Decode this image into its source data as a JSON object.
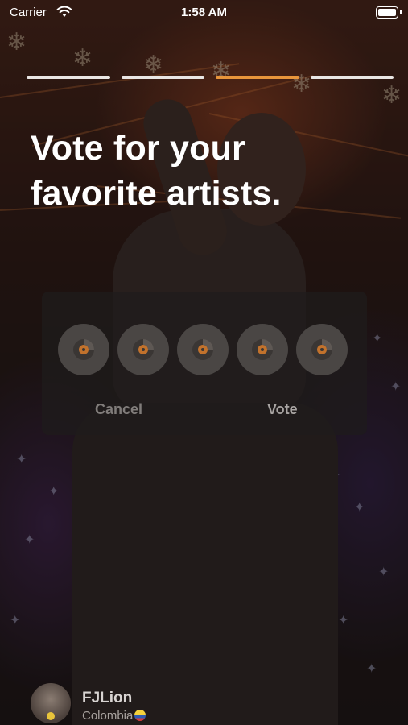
{
  "status_bar": {
    "carrier": "Carrier",
    "time": "1:58 AM"
  },
  "progress": {
    "total_steps": 4,
    "current_step": 3
  },
  "headline": {
    "line1": "Vote for your",
    "line2": "favorite artists."
  },
  "vote_card": {
    "rating_options": [
      {
        "icon": "vinyl-record-icon"
      },
      {
        "icon": "vinyl-record-icon"
      },
      {
        "icon": "vinyl-record-icon"
      },
      {
        "icon": "vinyl-record-icon"
      },
      {
        "icon": "vinyl-record-icon"
      }
    ],
    "cancel_label": "Cancel",
    "vote_label": "Vote"
  },
  "artist": {
    "name": "FJLion",
    "country": "Colombia",
    "flag_icon": "colombia-flag-icon"
  },
  "colors": {
    "accent": "#e8953b",
    "progress_inactive": "#e9e6e4",
    "card_bg": "#1e1c1c"
  }
}
